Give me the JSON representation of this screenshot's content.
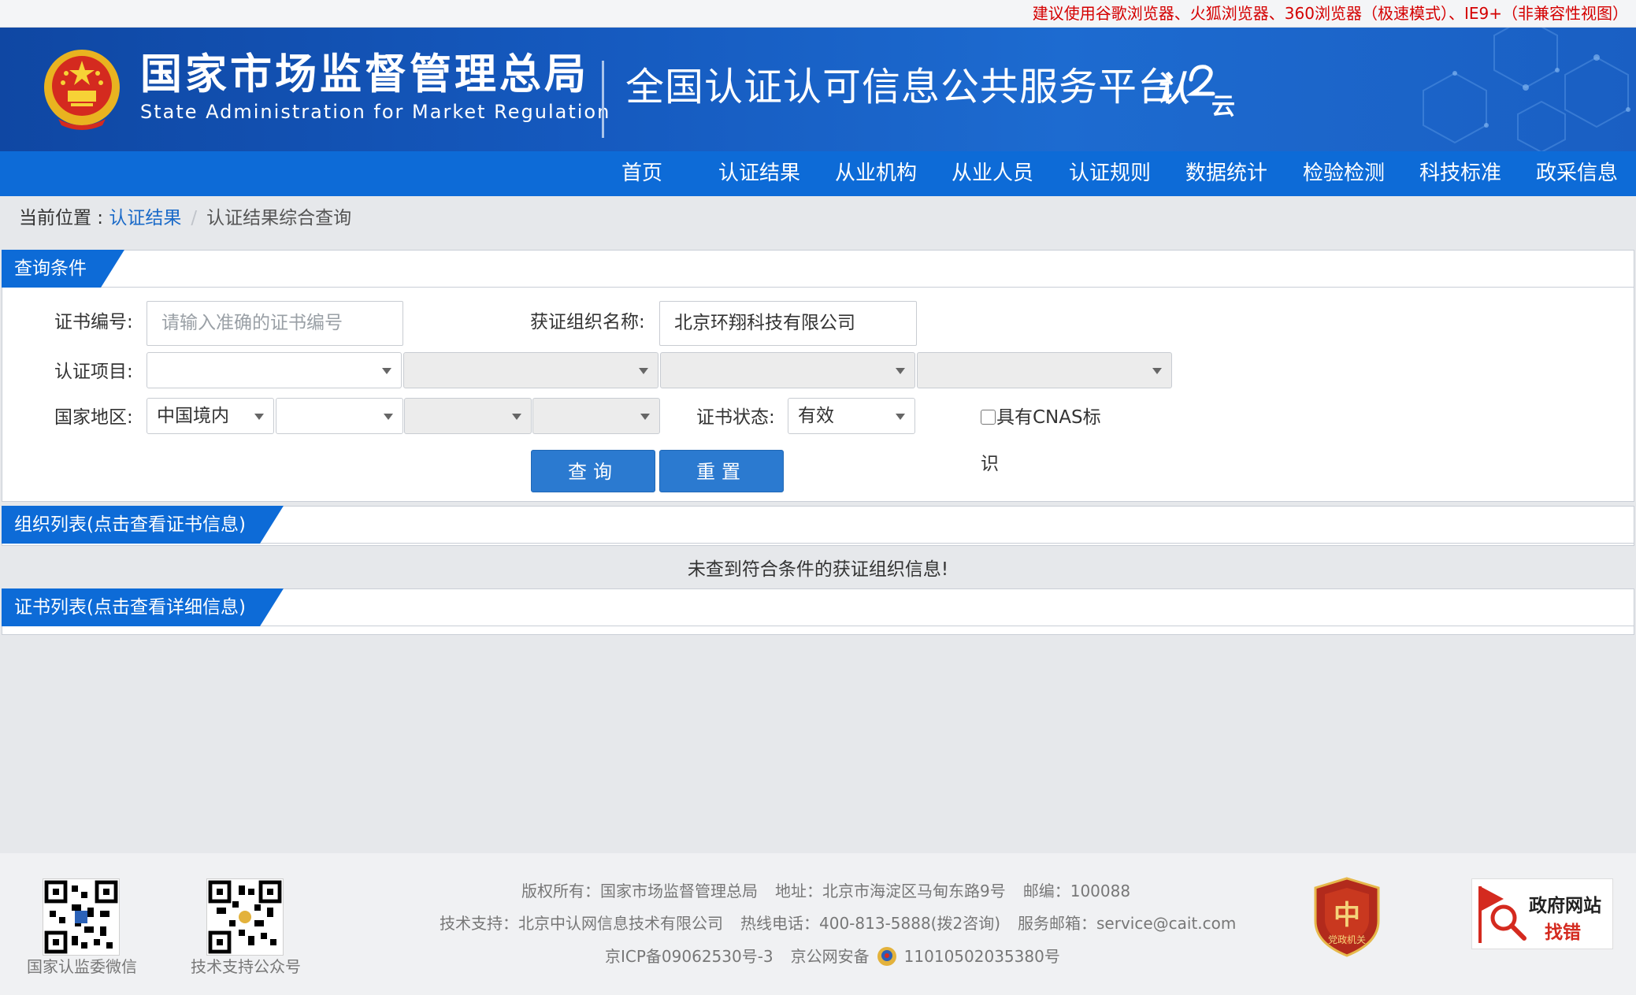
{
  "notice": "建议使用谷歌浏览器、火狐浏览器、360浏览器（极速模式）、IE9+（非兼容性视图）",
  "header": {
    "agency_cn": "国家市场监督管理总局",
    "agency_en": "State Administration  for  Market Regulation",
    "platform": "全国认证认可信息公共服务平台",
    "logo_text": "认",
    "logo_text2": "云"
  },
  "nav": [
    "首页",
    "认证结果",
    "从业机构",
    "从业人员",
    "认证规则",
    "数据统计",
    "检验检测",
    "科技标准",
    "政采信息"
  ],
  "breadcrumb": {
    "label": "当前位置 : ",
    "link": "认证结果",
    "sep": "/",
    "current": "认证结果综合查询"
  },
  "query": {
    "title": "查询条件",
    "cert_no_label": "证书编号:",
    "cert_no_placeholder": "请输入准确的证书编号",
    "org_name_label": "获证组织名称:",
    "org_name_value": "北京环翔科技有限公司",
    "project_label": "认证项目:",
    "region_label": "国家地区:",
    "region_value": "中国境内",
    "status_label": "证书状态:",
    "status_value": "有效",
    "cnas_label_1": "具有CNAS标",
    "cnas_label_2": "识",
    "search_btn": "查询",
    "reset_btn": "重置"
  },
  "org_list": {
    "title": "组织列表(点击查看证书信息)",
    "empty": "未查到符合条件的获证组织信息!"
  },
  "cert_list": {
    "title": "证书列表(点击查看详细信息)"
  },
  "footer": {
    "qr1_caption": "国家认监委微信",
    "qr2_caption": "技术支持公众号",
    "copyright": "版权所有：国家市场监督管理总局",
    "address": "地址：北京市海淀区马甸东路9号",
    "postcode": "邮编：100088",
    "tech_support": "技术支持：北京中认网信息技术有限公司",
    "hotline": "热线电话：400-813-5888(拨2咨询)",
    "email": "服务邮箱：service@cait.com",
    "icp": "京ICP备09062530号-3",
    "police": "京公网安备",
    "police_no": "11010502035380号",
    "badge_text": "党政机关",
    "findbox_title": "政府网站",
    "findbox_sub": "找错"
  }
}
